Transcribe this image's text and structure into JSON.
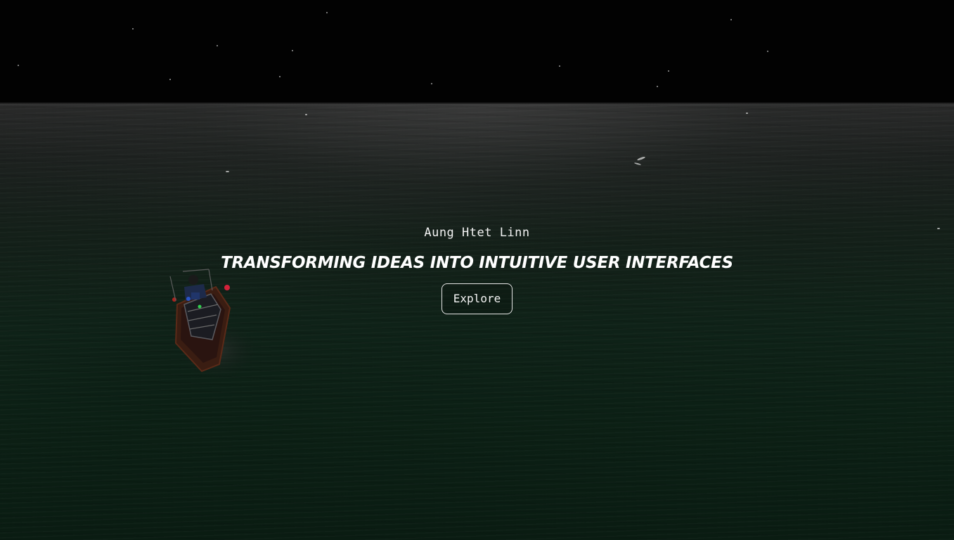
{
  "hero": {
    "author_name": "Aung Htet Linn",
    "tagline": "TRANSFORMING IDEAS INTO INTUITIVE USER INTERFACES",
    "explore_label": "Explore"
  },
  "scene": {
    "background": "night-ocean",
    "sky_color": "#020202",
    "sea_color": "#0f2218",
    "boat": "boat-with-figure"
  },
  "colors": {
    "text": "#ffffff",
    "button_border": "#e6e6e6"
  }
}
